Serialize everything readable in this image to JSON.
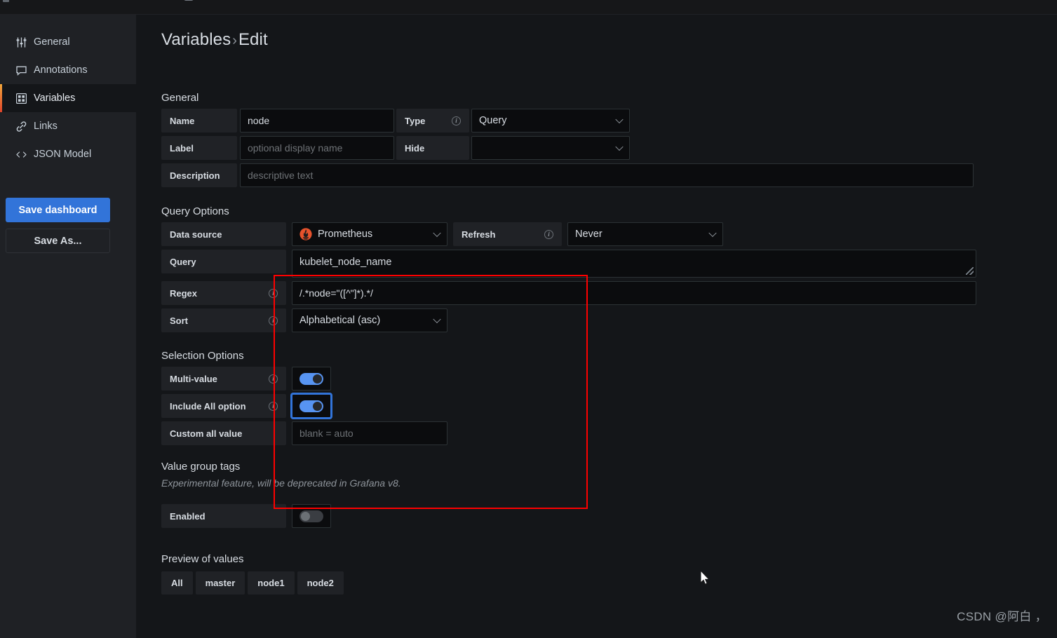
{
  "window": {
    "title": "Variables › Edit"
  },
  "sidebar": {
    "items": [
      {
        "label": "General",
        "icon": "sliders-icon",
        "active": false
      },
      {
        "label": "Annotations",
        "icon": "comment-icon",
        "active": false
      },
      {
        "label": "Variables",
        "icon": "grid-squares-icon",
        "active": true
      },
      {
        "label": "Links",
        "icon": "link-icon",
        "active": false
      },
      {
        "label": "JSON Model",
        "icon": "code-brackets-icon",
        "active": false
      }
    ],
    "save_dashboard_label": "Save dashboard",
    "save_as_label": "Save As..."
  },
  "page": {
    "title_main": "Variables",
    "title_sep": "›",
    "title_sub": "Edit"
  },
  "general": {
    "heading": "General",
    "name_label": "Name",
    "name_value": "node",
    "type_label": "Type",
    "type_value": "Query",
    "label_label": "Label",
    "label_placeholder": "optional display name",
    "hide_label": "Hide",
    "hide_value": "",
    "description_label": "Description",
    "description_placeholder": "descriptive text"
  },
  "query_options": {
    "heading": "Query Options",
    "datasource_label": "Data source",
    "datasource_value": "Prometheus",
    "datasource_icon": "prometheus-icon",
    "refresh_label": "Refresh",
    "refresh_value": "Never",
    "query_label": "Query",
    "query_value": "kubelet_node_name",
    "regex_label": "Regex",
    "regex_value": "/.*node=\"([^\"]*).*/",
    "sort_label": "Sort",
    "sort_value": "Alphabetical (asc)"
  },
  "selection_options": {
    "heading": "Selection Options",
    "multi_value_label": "Multi-value",
    "multi_value_on": true,
    "include_all_label": "Include All option",
    "include_all_on": true,
    "include_all_focused": true,
    "custom_all_label": "Custom all value",
    "custom_all_placeholder": "blank = auto"
  },
  "value_group_tags": {
    "heading": "Value group tags",
    "note": "Experimental feature, will be deprecated in Grafana v8.",
    "enabled_label": "Enabled",
    "enabled_on": false
  },
  "preview": {
    "heading": "Preview of values",
    "chips": [
      "All",
      "master",
      "node1",
      "node2"
    ]
  },
  "watermark": {
    "text": "CSDN @阿白 ，"
  },
  "colors": {
    "accent_blue": "#3274d9",
    "toggle_on": "#5794f2",
    "annotation_red": "#fe0000",
    "panel_bg": "#141619",
    "sidebar_bg": "#1f2125",
    "field_label_bg": "#202226",
    "input_bg": "#0b0c0e",
    "prometheus_orange": "#e6522c"
  }
}
